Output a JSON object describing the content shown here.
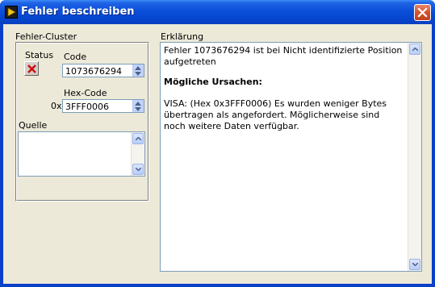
{
  "window": {
    "title": "Fehler beschreiben"
  },
  "cluster": {
    "label": "Fehler-Cluster",
    "status_label": "Status",
    "code_label": "Code",
    "code_value": "1073676294",
    "hex_label": "Hex-Code",
    "hex_prefix": "0x",
    "hex_value": "3FFF0006",
    "source_label": "Quelle",
    "source_value": ""
  },
  "explanation": {
    "label": "Erklärung",
    "line1": "Fehler 1073676294 ist bei Nicht identifizierte Position aufgetreten",
    "heading": "Mögliche Ursachen:",
    "detail": "VISA:  (Hex 0x3FFF0006) Es wurden weniger Bytes übertragen als angefordert. Möglicherweise sind noch weitere Daten verfügbar."
  },
  "colors": {
    "titlebar": "#0b4fd8",
    "client": "#ece9d8",
    "close": "#d3542f",
    "status_x": "#cc1111"
  }
}
